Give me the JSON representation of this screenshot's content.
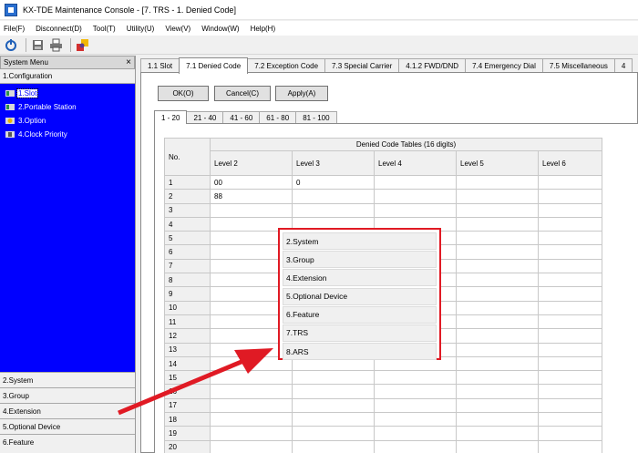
{
  "window": {
    "title": "KX-TDE Maintenance Console - [7. TRS - 1. Denied Code]"
  },
  "menubar": [
    "File(F)",
    "Disconnect(D)",
    "Tool(T)",
    "Utility(U)",
    "View(V)",
    "Window(W)",
    "Help(H)"
  ],
  "sysmenu": {
    "header": "System Menu",
    "close_glyph": "×",
    "config_label": "1.Configuration",
    "tree": [
      "1.Slot",
      "2.Portable Station",
      "3.Option",
      "4.Clock Priority"
    ],
    "bottom": [
      "2.System",
      "3.Group",
      "4.Extension",
      "5.Optional Device",
      "6.Feature"
    ]
  },
  "tabs": [
    "1.1 Slot",
    "7.1 Denied Code",
    "7.2 Exception Code",
    "7.3 Special Carrier",
    "4.1.2 FWD/DND",
    "7.4 Emergency Dial",
    "7.5 Miscellaneous",
    "4"
  ],
  "active_tab": 1,
  "buttons": {
    "ok": "OK(O)",
    "cancel": "Cancel(C)",
    "apply": "Apply(A)"
  },
  "subtabs": [
    "1 - 20",
    "21 - 40",
    "41 - 60",
    "61 - 80",
    "81 - 100"
  ],
  "table": {
    "no_header": "No.",
    "group_header": "Denied Code Tables (16 digits)",
    "levels": [
      "Level 2",
      "Level 3",
      "Level 4",
      "Level 5",
      "Level 6"
    ],
    "rows": [
      [
        "1",
        "00",
        "0",
        "",
        "",
        ""
      ],
      [
        "2",
        "88",
        "",
        "",
        "",
        ""
      ],
      [
        "3",
        "",
        "",
        "",
        "",
        ""
      ],
      [
        "4",
        "",
        "",
        "",
        "",
        ""
      ],
      [
        "5",
        "",
        "",
        "",
        "",
        ""
      ],
      [
        "6",
        "",
        "",
        "",
        "",
        ""
      ],
      [
        "7",
        "",
        "",
        "",
        "",
        ""
      ],
      [
        "8",
        "",
        "",
        "",
        "",
        ""
      ],
      [
        "9",
        "",
        "",
        "",
        "",
        ""
      ],
      [
        "10",
        "",
        "",
        "",
        "",
        ""
      ],
      [
        "11",
        "",
        "",
        "",
        "",
        ""
      ],
      [
        "12",
        "",
        "",
        "",
        "",
        ""
      ],
      [
        "13",
        "",
        "",
        "",
        "",
        ""
      ],
      [
        "14",
        "",
        "",
        "",
        "",
        ""
      ],
      [
        "15",
        "",
        "",
        "",
        "",
        ""
      ],
      [
        "16",
        "",
        "",
        "",
        "",
        ""
      ],
      [
        "17",
        "",
        "",
        "",
        "",
        ""
      ],
      [
        "18",
        "",
        "",
        "",
        "",
        ""
      ],
      [
        "19",
        "",
        "",
        "",
        "",
        ""
      ],
      [
        "20",
        "",
        "",
        "",
        "",
        ""
      ]
    ]
  },
  "popup": [
    "2.System",
    "3.Group",
    "4.Extension",
    "5.Optional Device",
    "6.Feature",
    "7.TRS",
    "8.ARS"
  ],
  "colors": {
    "tree_bg": "#0000ff",
    "highlight": "#e01a24"
  }
}
